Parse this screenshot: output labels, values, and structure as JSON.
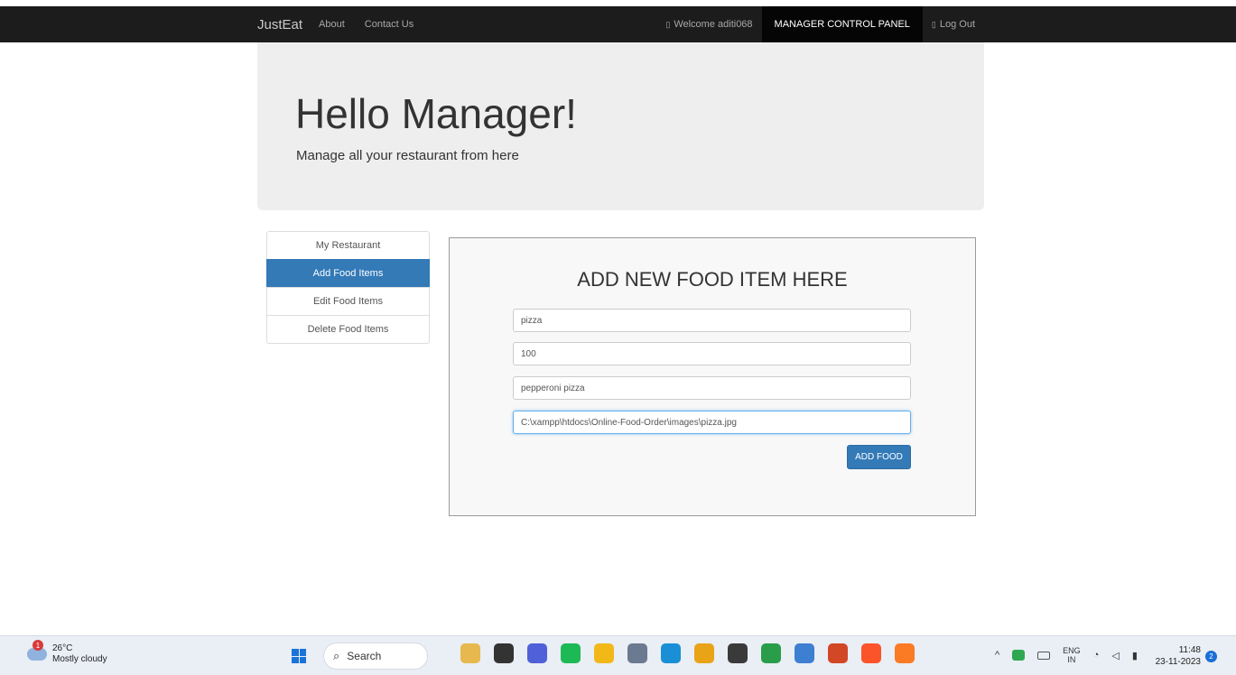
{
  "navbar": {
    "brand": "JustEat",
    "links": [
      "About",
      "Contact Us"
    ],
    "welcome": "Welcome aditi068",
    "control_panel": "MANAGER CONTROL PANEL",
    "logout": "Log Out",
    "glyph": "▯"
  },
  "jumbotron": {
    "title": "Hello Manager!",
    "subtitle": "Manage all your restaurant from here"
  },
  "sidebar": {
    "items": [
      "My Restaurant",
      "Add Food Items",
      "Edit Food Items",
      "Delete Food Items"
    ]
  },
  "form": {
    "heading": "ADD NEW FOOD ITEM HERE",
    "name_value": "pizza",
    "price_value": "100",
    "description_value": "pepperoni pizza",
    "image_path_value": "C:\\xampp\\htdocs\\Online-Food-Order\\images\\pizza.jpg",
    "submit_label": "ADD FOOD"
  },
  "taskbar": {
    "weather_temp": "26°C",
    "weather_desc": "Mostly cloudy",
    "weather_badge": "1",
    "search_label": "Search",
    "search_glyph": "⌕",
    "lang_top": "ENG",
    "lang_bottom": "IN",
    "time": "11:48",
    "date": "23-11-2023",
    "notification_count": "2",
    "tray_chevron": "^",
    "tray_wifi": "◔",
    "tray_sound": "◁",
    "tray_battery": "▮",
    "icons": [
      {
        "name": "widgets",
        "color": "#e6b84d"
      },
      {
        "name": "task-view",
        "color": "#333333"
      },
      {
        "name": "meet",
        "color": "#5060d8"
      },
      {
        "name": "spotify",
        "color": "#1db954"
      },
      {
        "name": "file-explorer",
        "color": "#f2b818"
      },
      {
        "name": "settings",
        "color": "#6b7a90"
      },
      {
        "name": "edge",
        "color": "#1a8fd6"
      },
      {
        "name": "chrome",
        "color": "#e8a317"
      },
      {
        "name": "camera",
        "color": "#3a3a3a"
      },
      {
        "name": "chrome-canary",
        "color": "#2a9d4b"
      },
      {
        "name": "notepad",
        "color": "#3d7fd1"
      },
      {
        "name": "powerpoint",
        "color": "#d24726"
      },
      {
        "name": "brave",
        "color": "#fb542b"
      },
      {
        "name": "xampp",
        "color": "#fb7a24"
      }
    ]
  }
}
